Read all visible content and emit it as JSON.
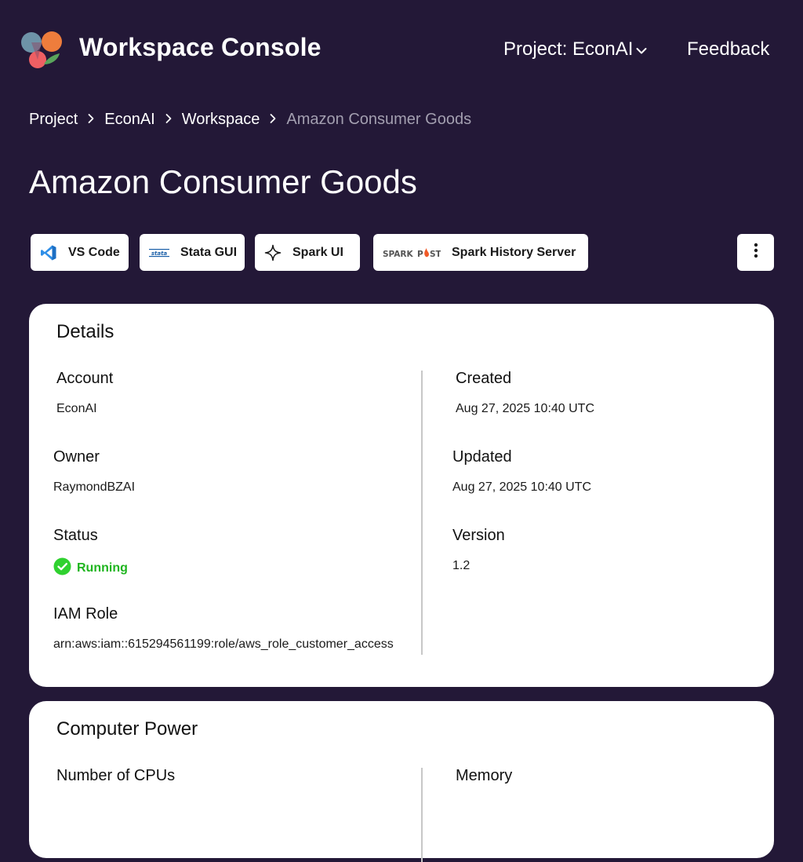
{
  "header": {
    "app_title": "Workspace Console",
    "project_label": "Project: EconAI",
    "feedback_label": "Feedback"
  },
  "breadcrumb": {
    "items": [
      "Project",
      "EconAI",
      "Workspace",
      "Amazon Consumer Goods"
    ],
    "separator": ">"
  },
  "page_title": "Amazon Consumer Goods",
  "toolbar": {
    "buttons": [
      {
        "label": "VS Code",
        "icon": "vscode-icon"
      },
      {
        "label": "Stata GUI",
        "icon": "stata-icon"
      },
      {
        "label": "Spark UI",
        "icon": "sparkle-icon"
      },
      {
        "label": "Spark History Server",
        "icon": "sparkpost-logo"
      }
    ],
    "more_icon": "more-vertical-icon"
  },
  "details": {
    "title": "Details",
    "account": {
      "label": "Account",
      "value": "EconAI"
    },
    "owner": {
      "label": "Owner",
      "value": "RaymondBZAI"
    },
    "status": {
      "label": "Status",
      "value": "Running",
      "color": "#1fb51f",
      "icon": "check-circle-icon"
    },
    "iam_role": {
      "label": "IAM Role",
      "value": "arn:aws:iam::615294561199:role/aws_role_customer_access"
    },
    "created": {
      "label": "Created",
      "value": "Aug 27, 2025 10:40 UTC"
    },
    "updated": {
      "label": "Updated",
      "value": "Aug 27, 2025 10:40 UTC"
    },
    "version": {
      "label": "Version",
      "value": "1.2"
    }
  },
  "compute": {
    "title": "Computer Power",
    "cpus": {
      "label": "Number of CPUs"
    },
    "memory": {
      "label": "Memory"
    }
  },
  "colors": {
    "background": "#231837",
    "card": "#ffffff",
    "status_running": "#1fb51f",
    "breadcrumb_current": "#a39fb0"
  }
}
